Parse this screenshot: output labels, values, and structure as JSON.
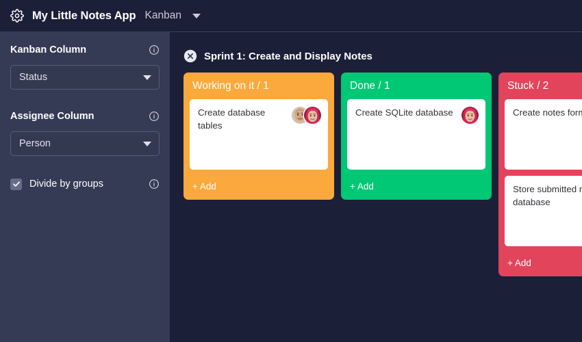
{
  "header": {
    "gear_icon": "gear-icon",
    "app_title": "My Little Notes App",
    "board_name": "Kanban",
    "board_caret_icon": "chevron-down-icon"
  },
  "sidebar": {
    "kanban_column": {
      "label": "Kanban Column",
      "info_icon": "info-icon",
      "selected": "Status",
      "caret_icon": "chevron-down-icon"
    },
    "assignee_column": {
      "label": "Assignee Column",
      "info_icon": "info-icon",
      "selected": "Person",
      "caret_icon": "chevron-down-icon"
    },
    "divide_by_groups": {
      "label": "Divide by groups",
      "checked": true,
      "check_icon": "check-icon",
      "info_icon": "info-icon"
    }
  },
  "board": {
    "group": {
      "collapse_icon": "circle-x-icon",
      "title": "Sprint 1: Create and Display Notes"
    },
    "add_label": "+ Add",
    "columns": [
      {
        "title": "Working on it / 1",
        "color": "#fba93c",
        "add_label": "+ Add",
        "cards": [
          {
            "text": "Create database tables",
            "avatars": [
              "avatar-bald-man",
              "avatar-pink-hair"
            ]
          }
        ]
      },
      {
        "title": "Done / 1",
        "color": "#00c875",
        "add_label": "+ Add",
        "cards": [
          {
            "text": "Create SQLite database",
            "avatars": [
              "avatar-pink-hair"
            ]
          }
        ]
      },
      {
        "title": "Stuck / 2",
        "color": "#e2445c",
        "add_label": "+ Add",
        "cards": [
          {
            "text": "Create notes form",
            "avatars": []
          },
          {
            "text": "Store submitted notes in database",
            "avatars": []
          }
        ]
      }
    ]
  },
  "colors": {
    "page_background": "#1b1f38",
    "sidebar_background": "#353b54",
    "header_background": "#1b1f38",
    "card_background": "#ffffff",
    "orange": "#fba93c",
    "green": "#00c875",
    "red": "#e2445c"
  }
}
